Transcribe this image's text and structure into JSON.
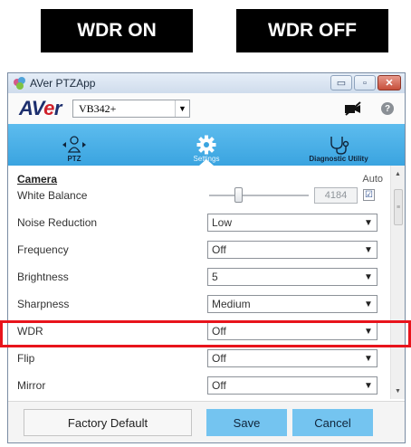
{
  "labels": {
    "wdr_on": "WDR ON",
    "wdr_off": "WDR OFF"
  },
  "window": {
    "title": "AVer PTZApp",
    "controls": {
      "minimize": "▭",
      "maximize": "▫",
      "close": "✕"
    }
  },
  "toolbar": {
    "logo_prefix": "AV",
    "logo_e": "e",
    "logo_suffix": "r",
    "camera_select": "VB342+",
    "help": "?"
  },
  "tabs": [
    {
      "label": "PTZ",
      "icon": "ptz-icon"
    },
    {
      "label": "Settings",
      "icon": "gear-icon",
      "active": true
    },
    {
      "label": "Diagnostic Utility",
      "icon": "stethoscope-icon"
    }
  ],
  "camera": {
    "section_title": "Camera",
    "auto_label": "Auto",
    "white_balance": {
      "label": "White Balance",
      "value": "4184",
      "auto_checked": "☑"
    },
    "settings": [
      {
        "label": "Noise Reduction",
        "value": "Low"
      },
      {
        "label": "Frequency",
        "value": "Off"
      },
      {
        "label": "Brightness",
        "value": "5"
      },
      {
        "label": "Sharpness",
        "value": "Medium"
      },
      {
        "label": "WDR",
        "value": "Off"
      },
      {
        "label": "Flip",
        "value": "Off"
      },
      {
        "label": "Mirror",
        "value": "Off"
      }
    ]
  },
  "footer": {
    "factory_default": "Factory Default",
    "save": "Save",
    "cancel": "Cancel"
  },
  "colors": {
    "tab_bar": "#3aa4e0",
    "highlight": "#e8141c",
    "button_blue": "#74c4f0"
  }
}
